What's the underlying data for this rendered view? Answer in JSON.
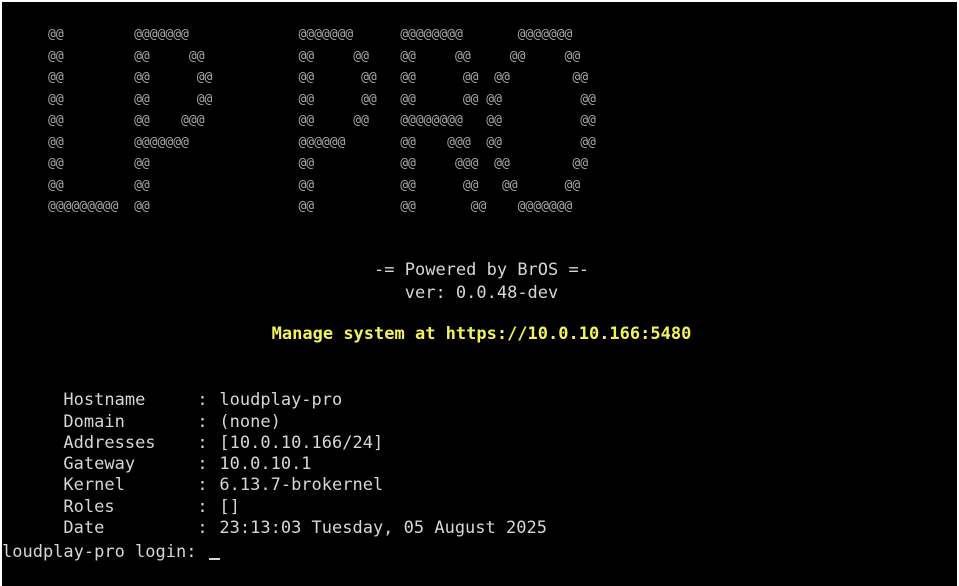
{
  "console": {
    "banner_art": [
      "@@         @@@@@@@              @@@@@@@      @@@@@@@@       @@@@@@@",
      "@@         @@     @@            @@     @@    @@     @@     @@     @@",
      "@@         @@      @@           @@      @@   @@      @@  @@        @@",
      "@@         @@      @@           @@      @@   @@      @@ @@          @@",
      "@@         @@    @@@            @@     @@    @@@@@@@@   @@          @@",
      "@@         @@@@@@@              @@@@@@       @@    @@@  @@          @@",
      "@@         @@                   @@           @@     @@@  @@        @@",
      "@@         @@                   @@           @@      @@   @@      @@",
      "@@@@@@@@@  @@                   @@           @@       @@    @@@@@@@"
    ],
    "powered_by": "-= Powered by BrOS =-",
    "version": "ver: 0.0.48-dev",
    "manage_message": "Manage system at https://10.0.10.166:5480",
    "info": [
      {
        "key": "Hostname",
        "value": "loudplay-pro"
      },
      {
        "key": "Domain",
        "value": "(none)"
      },
      {
        "key": "Addresses",
        "value": "[10.0.10.166/24]"
      },
      {
        "key": "Gateway",
        "value": "10.0.10.1"
      },
      {
        "key": "Kernel",
        "value": "6.13.7-brokernel"
      },
      {
        "key": "Roles",
        "value": "[]"
      },
      {
        "key": "Date",
        "value": "23:13:03 Tuesday, 05 August 2025"
      }
    ],
    "separator": ":",
    "login_prompt": "loudplay-pro login: ",
    "colors": {
      "background": "#000000",
      "text": "#d6d6d6",
      "banner": "#a8a8a8",
      "highlight": "#f2f25a"
    }
  }
}
